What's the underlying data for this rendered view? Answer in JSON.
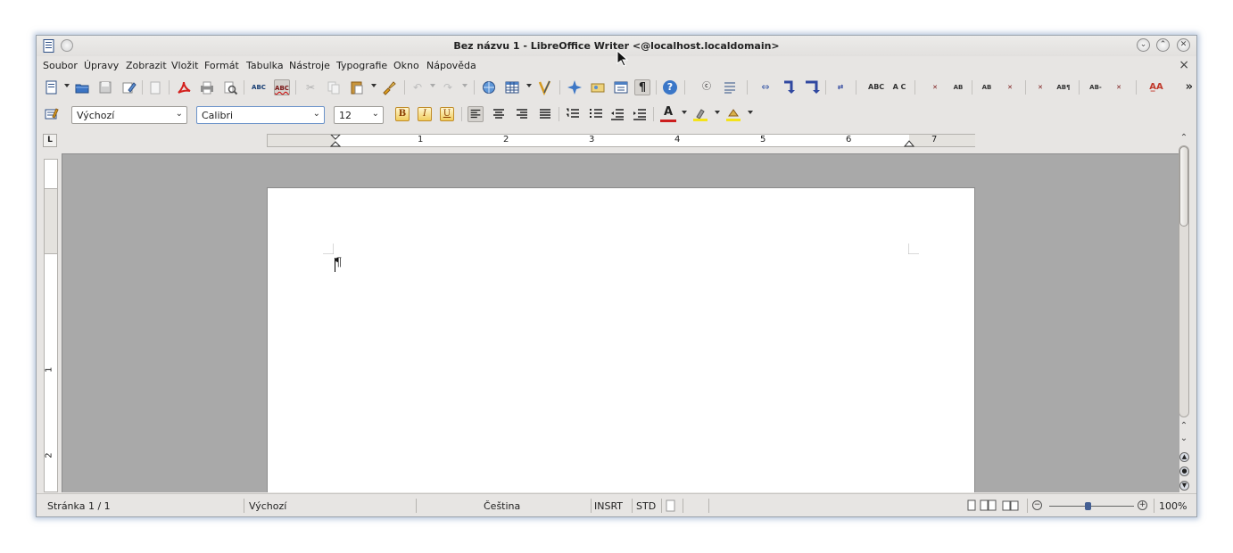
{
  "window": {
    "title": "Bez názvu 1 - LibreOffice Writer <@localhost.localdomain>",
    "minimize_icon": "chevron-down-icon",
    "maximize_icon": "chevron-up-icon",
    "close_icon": "close-icon"
  },
  "menu": {
    "items": [
      "Soubor",
      "Úpravy",
      "Zobrazit",
      "Vložit",
      "Formát",
      "Tabulka",
      "Nástroje",
      "Typografie",
      "Okno",
      "Nápověda"
    ],
    "close_doc": "×"
  },
  "toolbar1": {
    "more": "»",
    "spellcheck_label": "ABC",
    "autospell_label": "ABC",
    "help_label": "?",
    "pilcrow": "¶",
    "icons": [
      "new-document-icon",
      "open-icon",
      "save-icon",
      "edit-file-icon",
      "export-pdf-icon",
      "print-icon",
      "print-preview-icon",
      "spellcheck-icon",
      "autospellcheck-icon",
      "cut-icon",
      "copy-icon",
      "paste-icon",
      "clone-formatting-icon",
      "undo-icon",
      "redo-icon",
      "hyperlink-icon",
      "table-icon",
      "draw-functions-icon",
      "navigator-icon",
      "gallery-icon",
      "data-sources-icon",
      "formatting-marks-icon",
      "help-icon"
    ]
  },
  "toolbar2": {
    "style_value": "Výchozí",
    "font_value": "Calibri",
    "size_value": "12",
    "bold": "B",
    "italic": "I",
    "underline": "U",
    "font_color_letter": "A"
  },
  "ruler": {
    "tabstop_marker": "L",
    "h_numbers": [
      "1",
      "2",
      "3",
      "4",
      "5",
      "6",
      "7"
    ],
    "v_numbers": [
      "1",
      "2"
    ]
  },
  "status": {
    "page": "Stránka 1 / 1",
    "style": "Výchozí",
    "language": "Čeština",
    "insert_mode": "INSRT",
    "selection_mode": "STD",
    "zoom": "100%",
    "zoom_level": 1.0
  },
  "colors": {
    "window_bg": "#e7e5e3",
    "workspace_bg": "#a9a9a9",
    "page_bg": "#ffffff",
    "accent": "#445f93"
  }
}
